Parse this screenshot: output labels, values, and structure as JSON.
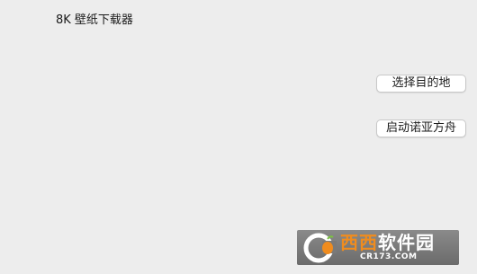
{
  "window": {
    "title": "8K 壁纸下载器"
  },
  "buttons": {
    "select_destination": "选择目的地",
    "start_ark": "启动诺亚方舟"
  },
  "watermark": {
    "brand_orange": "西西",
    "brand_white": "软件园",
    "domain": "CR173.COM",
    "colors": {
      "orange": "#f08c1e",
      "white": "#ffffff",
      "background": "#7a7a7a"
    }
  }
}
